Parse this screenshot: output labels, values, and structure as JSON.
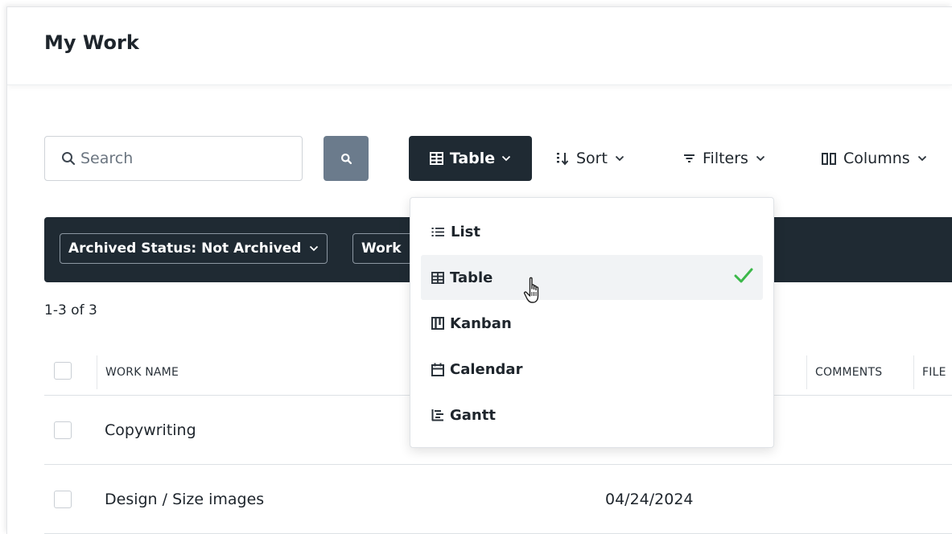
{
  "header": {
    "title": "My Work"
  },
  "toolbar": {
    "search_placeholder": "Search",
    "view_label": "Table",
    "sort_label": "Sort",
    "filters_label": "Filters",
    "columns_label": "Columns"
  },
  "filter_bar": {
    "chips": [
      {
        "label": "Archived Status: Not Archived"
      },
      {
        "label": "Work"
      }
    ]
  },
  "results": {
    "count_text": "1-3 of 3"
  },
  "table": {
    "headers": {
      "work_name": "WORK NAME",
      "comments": "COMMENTS",
      "files": "FILE"
    },
    "rows": [
      {
        "work_name": "Copywriting",
        "date": ""
      },
      {
        "work_name": "Design / Size images",
        "date": "04/24/2024"
      }
    ]
  },
  "view_menu": {
    "selected": "Table",
    "items": [
      {
        "label": "List",
        "icon": "list-icon"
      },
      {
        "label": "Table",
        "icon": "table-icon"
      },
      {
        "label": "Kanban",
        "icon": "kanban-icon"
      },
      {
        "label": "Calendar",
        "icon": "calendar-icon"
      },
      {
        "label": "Gantt",
        "icon": "gantt-icon"
      }
    ]
  },
  "colors": {
    "dark": "#1f2a33",
    "search_button": "#6b7b8c",
    "check_green": "#3cb84a"
  }
}
